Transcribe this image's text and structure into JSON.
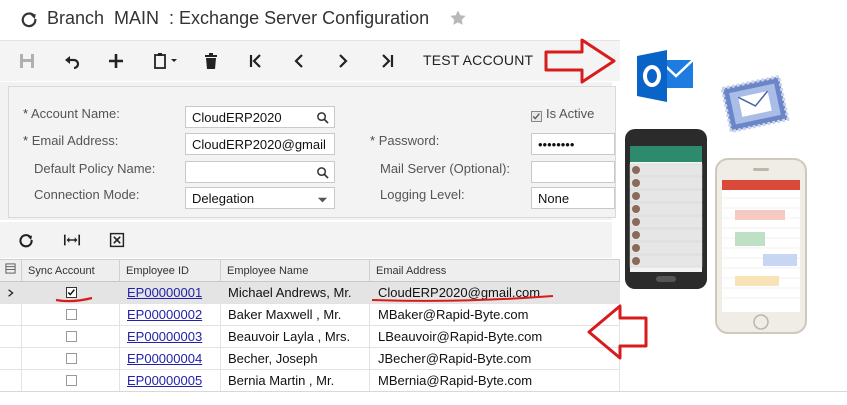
{
  "header": {
    "title": "Branch  MAIN  : Exchange Server Configuration"
  },
  "toolbar": {
    "test_account_label": "TEST ACCOUNT"
  },
  "form": {
    "account_name": {
      "label": "Account Name:",
      "value": "CloudERP2020"
    },
    "email_address": {
      "label": "Email Address:",
      "value": "CloudERP2020@gmail"
    },
    "default_policy_name": {
      "label": "Default Policy Name:",
      "value": ""
    },
    "connection_mode": {
      "label": "Connection Mode:",
      "value": "Delegation"
    },
    "is_active": {
      "label": "Is Active",
      "checked": true
    },
    "password": {
      "label": "Password:",
      "value": "••••••••"
    },
    "mail_server": {
      "label": "Mail Server (Optional):",
      "value": ""
    },
    "logging_level": {
      "label": "Logging Level:",
      "value": "None"
    },
    "required_mark": "*"
  },
  "table": {
    "columns": [
      "Sync Account",
      "Employee ID",
      "Employee Name",
      "Email Address"
    ],
    "rows": [
      {
        "sync": true,
        "id": "EP00000001",
        "name": "Michael Andrews, Mr.",
        "email": "CloudERP2020@gmail.com",
        "selected": true
      },
      {
        "sync": false,
        "id": "EP00000002",
        "name": "Baker Maxwell , Mr.",
        "email": "MBaker@Rapid-Byte.com",
        "selected": false
      },
      {
        "sync": false,
        "id": "EP00000003",
        "name": "Beauvoir Layla , Mrs.",
        "email": "LBeauvoir@Rapid-Byte.com",
        "selected": false
      },
      {
        "sync": false,
        "id": "EP00000004",
        "name": "Becher, Joseph",
        "email": "JBecher@Rapid-Byte.com",
        "selected": false
      },
      {
        "sync": false,
        "id": "EP00000005",
        "name": "Bernia Martin , Mr.",
        "email": "MBernia@Rapid-Byte.com",
        "selected": false
      }
    ]
  },
  "colors": {
    "annotation_red": "#d81b1b",
    "link_blue": "#2222aa",
    "outlook_blue": "#0a64c8"
  },
  "icons": [
    "refresh-icon",
    "star-icon",
    "save-icon",
    "undo-icon",
    "add-icon",
    "copy-paste-icon",
    "delete-icon",
    "first-icon",
    "previous-icon",
    "next-icon",
    "last-icon",
    "search-icon",
    "dropdown-icon",
    "fit-columns-icon",
    "export-excel-icon",
    "outlook-logo-icon",
    "mail-stamp-icon"
  ]
}
